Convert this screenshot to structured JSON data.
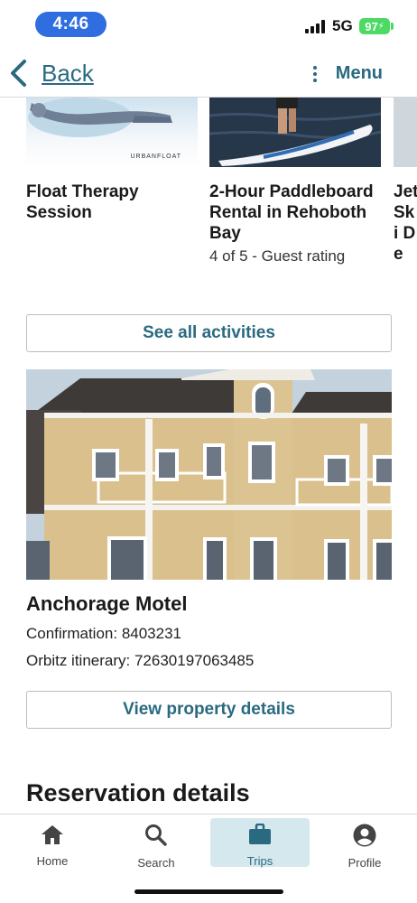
{
  "status_bar": {
    "time": "4:46",
    "network": "5G",
    "battery": "97"
  },
  "nav": {
    "back_label": "Back",
    "menu_label": "Menu"
  },
  "activities": [
    {
      "title": "Float Therapy Session",
      "image_logo": "URBANFLOAT",
      "rating": ""
    },
    {
      "title": "2-Hour Paddleboard Rental in Rehoboth Bay",
      "rating": "4 of 5 - Guest rating"
    },
    {
      "title": "Jet Ski De"
    }
  ],
  "see_all_label": "See all activities",
  "hotel": {
    "name": "Anchorage Motel",
    "confirmation": "Confirmation: 8403231",
    "itinerary": "Orbitz itinerary: 72630197063485",
    "details_label": "View property details"
  },
  "reservation_title": "Reservation details",
  "tabs": [
    {
      "label": "Home",
      "icon": "home-icon"
    },
    {
      "label": "Search",
      "icon": "search-icon"
    },
    {
      "label": "Trips",
      "icon": "briefcase-icon",
      "active": true
    },
    {
      "label": "Profile",
      "icon": "profile-icon"
    }
  ],
  "colors": {
    "accent": "#2a6a80",
    "time_pill": "#2f6ee0",
    "battery": "#4cd964",
    "active_tab_bg": "#d5e8ee"
  }
}
